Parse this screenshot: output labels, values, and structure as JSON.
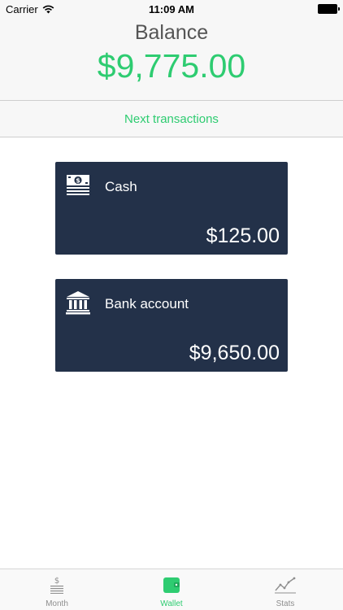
{
  "status_bar": {
    "carrier": "Carrier",
    "time": "11:09 AM"
  },
  "header": {
    "balance_label": "Balance",
    "balance_amount": "$9,775.00"
  },
  "next_transactions_label": "Next transactions",
  "accounts": [
    {
      "name": "Cash",
      "amount": "$125.00",
      "icon": "cash-icon"
    },
    {
      "name": "Bank account",
      "amount": "$9,650.00",
      "icon": "bank-icon"
    }
  ],
  "tab_bar": {
    "tabs": [
      {
        "label": "Month",
        "icon": "month-icon",
        "active": false
      },
      {
        "label": "Wallet",
        "icon": "wallet-icon",
        "active": true
      },
      {
        "label": "Stats",
        "icon": "stats-icon",
        "active": false
      }
    ]
  },
  "colors": {
    "accent": "#2ecc71",
    "card": "#233149",
    "header_bg": "#f7f7f7",
    "tab_inactive": "#8e8e8e"
  }
}
